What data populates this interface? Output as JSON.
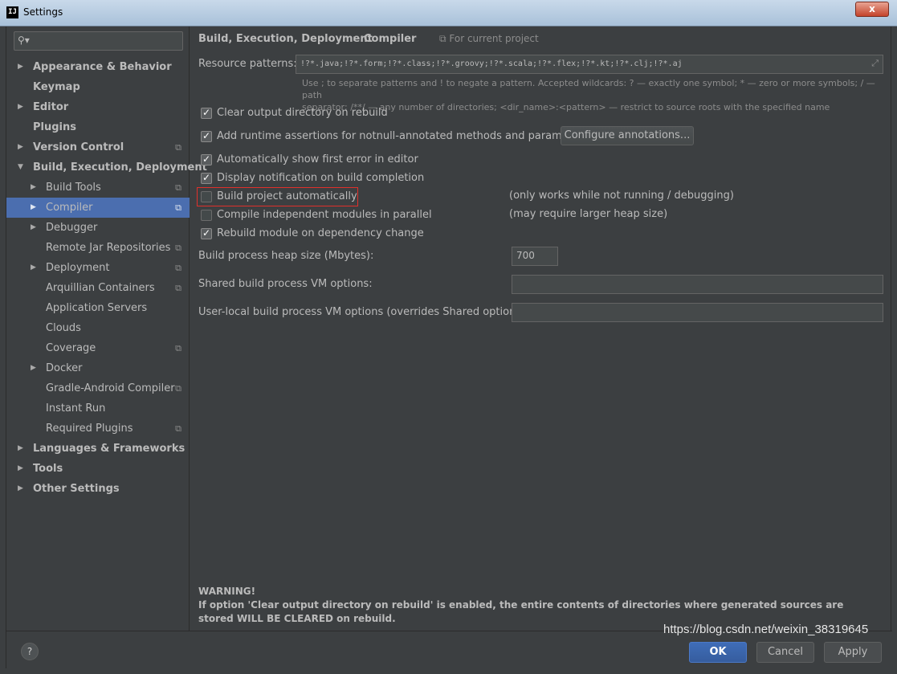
{
  "window": {
    "title": "Settings",
    "close_label": "x",
    "app_icon": "IJ"
  },
  "search": {
    "placeholder": ""
  },
  "sidebar": {
    "items": [
      {
        "label": "Appearance & Behavior"
      },
      {
        "label": "Keymap"
      },
      {
        "label": "Editor"
      },
      {
        "label": "Plugins"
      },
      {
        "label": "Version Control"
      },
      {
        "label": "Build, Execution, Deployment"
      },
      {
        "label": "Build Tools"
      },
      {
        "label": "Compiler"
      },
      {
        "label": "Debugger"
      },
      {
        "label": "Remote Jar Repositories"
      },
      {
        "label": "Deployment"
      },
      {
        "label": "Arquillian Containers"
      },
      {
        "label": "Application Servers"
      },
      {
        "label": "Clouds"
      },
      {
        "label": "Coverage"
      },
      {
        "label": "Docker"
      },
      {
        "label": "Gradle-Android Compiler"
      },
      {
        "label": "Instant Run"
      },
      {
        "label": "Required Plugins"
      },
      {
        "label": "Languages & Frameworks"
      },
      {
        "label": "Tools"
      },
      {
        "label": "Other Settings"
      }
    ]
  },
  "breadcrumb": {
    "parent": "Build, Execution, Deployment",
    "separator": "›",
    "current": "Compiler",
    "scope": "For current project"
  },
  "resource_patterns": {
    "label": "Resource patterns:",
    "value": "!?*.java;!?*.form;!?*.class;!?*.groovy;!?*.scala;!?*.flex;!?*.kt;!?*.clj;!?*.aj",
    "hint_line1": "Use ; to separate patterns and ! to negate a pattern. Accepted wildcards: ? — exactly one symbol; * — zero or more symbols; / — path",
    "hint_line2": "separator; /**/ — any number of directories; <dir_name>:<pattern> — restrict to source roots with the specified name"
  },
  "options": {
    "clear_output": "Clear output directory on rebuild",
    "runtime_assertions": "Add runtime assertions for notnull-annotated methods and parameters",
    "configure_annotations": "Configure annotations...",
    "show_first_error": "Automatically show first error in editor",
    "display_notification": "Display notification on build completion",
    "build_automatically": "Build project automatically",
    "build_automatically_note": "(only works while not running / debugging)",
    "compile_parallel": "Compile independent modules in parallel",
    "compile_parallel_note": "(may require larger heap size)",
    "rebuild_module": "Rebuild module on dependency change"
  },
  "heap": {
    "label": "Build process heap size (Mbytes):",
    "value": "700"
  },
  "shared_vm": {
    "label": "Shared build process VM options:",
    "value": ""
  },
  "user_vm": {
    "label": "User-local build process VM options (overrides Shared options):",
    "value": ""
  },
  "warning": {
    "title": "WARNING!",
    "body": "If option 'Clear output directory on rebuild' is enabled, the entire contents of directories where generated sources are stored WILL BE CLEARED on rebuild."
  },
  "footer": {
    "help": "?",
    "ok": "OK",
    "cancel": "Cancel",
    "apply": "Apply"
  },
  "watermark": "https://blog.csdn.net/weixin_38319645"
}
